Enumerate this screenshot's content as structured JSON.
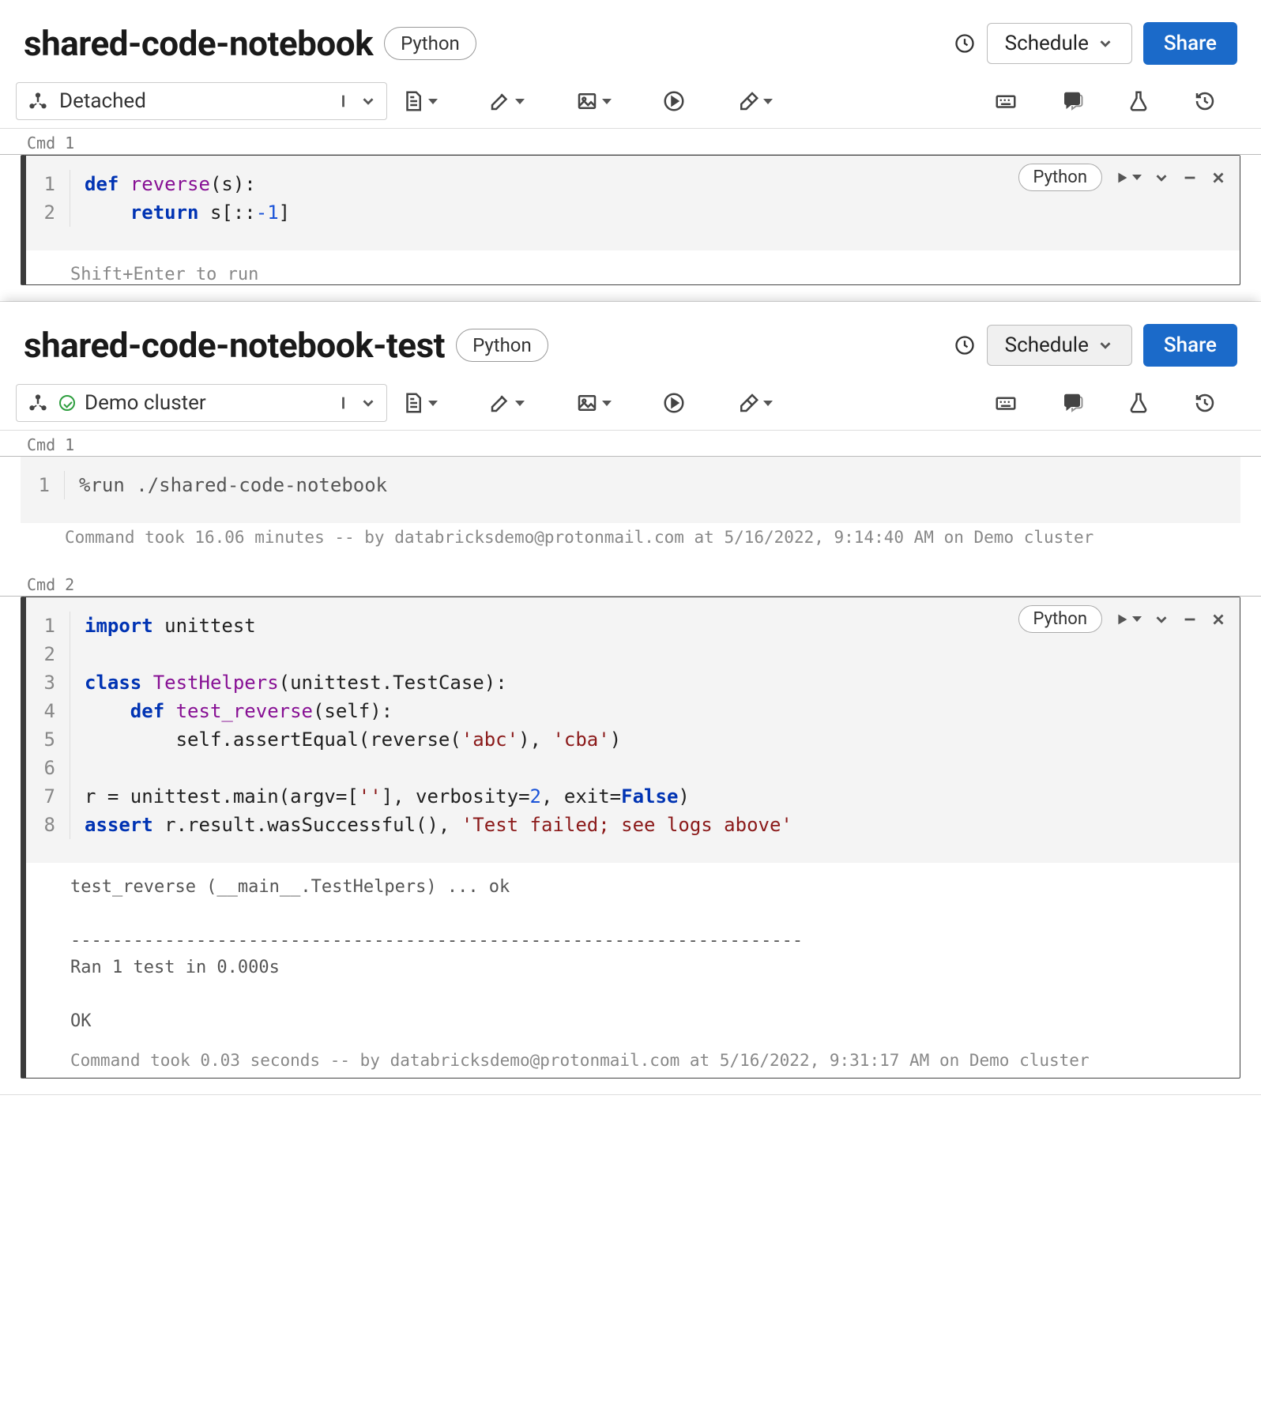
{
  "notebooks": [
    {
      "title": "shared-code-notebook",
      "language": "Python",
      "schedule_label": "Schedule",
      "share_label": "Share",
      "cluster_label": "Detached",
      "cluster_connected": false,
      "cmd_labels": [
        "Cmd 1"
      ],
      "cells": [
        {
          "focused": true,
          "lang_pill": "Python",
          "lines": [
            [
              {
                "t": "def ",
                "c": "kw"
              },
              {
                "t": "reverse",
                "c": "fn"
              },
              {
                "t": "(s):",
                "c": ""
              }
            ],
            [
              {
                "t": "    ",
                "c": ""
              },
              {
                "t": "return",
                "c": "kw"
              },
              {
                "t": " s[::",
                "c": ""
              },
              {
                "t": "-1",
                "c": "num"
              },
              {
                "t": "]",
                "c": ""
              }
            ]
          ],
          "hint": "Shift+Enter to run"
        }
      ]
    },
    {
      "title": "shared-code-notebook-test",
      "language": "Python",
      "schedule_label": "Schedule",
      "share_label": "Share",
      "cluster_label": "Demo cluster",
      "cluster_connected": true,
      "schedule_highlight": true,
      "cmd_labels": [
        "Cmd 1",
        "Cmd 2"
      ],
      "cells": [
        {
          "focused": false,
          "lines": [
            [
              {
                "t": "%run ./shared-code-notebook",
                "c": "mag"
              }
            ]
          ],
          "meta": "Command took 16.06 minutes -- by databricksdemo@protonmail.com at 5/16/2022, 9:14:40 AM on Demo cluster"
        },
        {
          "focused": true,
          "lang_pill": "Python",
          "lines": [
            [
              {
                "t": "import",
                "c": "kw"
              },
              {
                "t": " unittest",
                "c": ""
              }
            ],
            [
              {
                "t": "",
                "c": ""
              }
            ],
            [
              {
                "t": "class ",
                "c": "kw"
              },
              {
                "t": "TestHelpers",
                "c": "cls"
              },
              {
                "t": "(unittest.TestCase):",
                "c": ""
              }
            ],
            [
              {
                "t": "    ",
                "c": ""
              },
              {
                "t": "def ",
                "c": "kw"
              },
              {
                "t": "test_reverse",
                "c": "fn"
              },
              {
                "t": "(self):",
                "c": ""
              }
            ],
            [
              {
                "t": "        self.assertEqual(reverse(",
                "c": ""
              },
              {
                "t": "'abc'",
                "c": "str"
              },
              {
                "t": "), ",
                "c": ""
              },
              {
                "t": "'cba'",
                "c": "str"
              },
              {
                "t": ")",
                "c": ""
              }
            ],
            [
              {
                "t": "",
                "c": ""
              }
            ],
            [
              {
                "t": "r = unittest.main(argv=[",
                "c": ""
              },
              {
                "t": "''",
                "c": "str"
              },
              {
                "t": "], verbosity=",
                "c": ""
              },
              {
                "t": "2",
                "c": "num"
              },
              {
                "t": ", exit=",
                "c": ""
              },
              {
                "t": "False",
                "c": "bool"
              },
              {
                "t": ")",
                "c": ""
              }
            ],
            [
              {
                "t": "assert",
                "c": "kw"
              },
              {
                "t": " r.result.wasSuccessful(), ",
                "c": ""
              },
              {
                "t": "'Test failed; see logs above'",
                "c": "str"
              }
            ]
          ],
          "output": "test_reverse (__main__.TestHelpers) ... ok\n\n----------------------------------------------------------------------\nRan 1 test in 0.000s\n\nOK",
          "meta": "Command took 0.03 seconds -- by databricksdemo@protonmail.com at 5/16/2022, 9:31:17 AM on Demo cluster"
        }
      ]
    }
  ]
}
